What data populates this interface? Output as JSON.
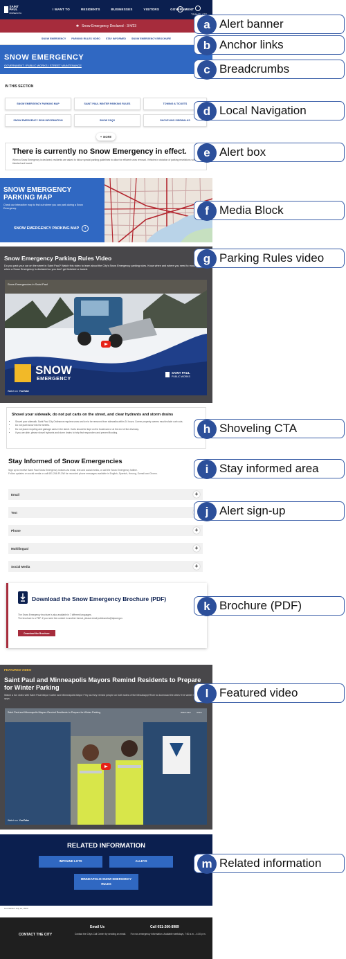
{
  "header": {
    "logo_line1": "SAINT PAUL",
    "logo_line2": "MINNESOTA",
    "nav": [
      "I WANT TO",
      "RESIDENTS",
      "BUSINESSES",
      "VISITORS",
      "GOVERNMENT"
    ],
    "translate": "TRANSLATE"
  },
  "alert_banner": {
    "text": "Snow Emergency Declared - 3/4/23"
  },
  "anchor_links": [
    "SNOW EMERGENCY",
    "PARKING RULES VIDEO",
    "STAY INFORMED",
    "SNOW EMERGENCY BROCHURE"
  ],
  "hero": {
    "title": "SNOW EMERGENCY",
    "breadcrumbs": "GOVERNMENT / PUBLIC WORKS / STREET MAINTENANCE"
  },
  "in_this_section": {
    "label": "IN THIS SECTION",
    "items": [
      "SNOW EMERGENCY PARKING MAP",
      "SAINT PAUL WINTER PARKING RULES",
      "TOWING & TICKETS",
      "SNOW EMERGENCY SIGN INFORMATION",
      "SNOW FAQS",
      "SHOVELING SIDEWALKS"
    ],
    "more_label": "MORE"
  },
  "alert_box": {
    "title": "There is currently no Snow Emergency in effect.",
    "text": "When a Snow Emergency is declared, residents are asked to follow special parking guidelines to allow for efficient snow removal. Vehicles in violation of parking restrictions will be ticketed and towed."
  },
  "media_block": {
    "title": "SNOW EMERGENCY PARKING MAP",
    "text": "Check our interactive map to find out where you can park during a Snow Emergency.",
    "link": "SNOW EMERGENCY PARKING MAP"
  },
  "parking_video": {
    "title": "Snow Emergency Parking Rules Video",
    "text": "Do you park your car on the street in Saint Paul? Watch this video to learn about the City's Snow Emergency parking rules. Know when and where you need to move your car when a Snow Emergency is declared so you don't get ticketed or towed.",
    "video_title": "Snow Emergencies in Saint Paul",
    "overlay_line1": "SNOW",
    "overlay_line2": "EMERGENCY",
    "brand_line1": "SAINT PAUL",
    "brand_line2": "PUBLIC WORKS",
    "watch_on": "Watch on",
    "youtube": "YouTube"
  },
  "shoveling": {
    "title": "Shovel your sidewalk, do not put carts on the street, and clear hydrants and storm drains",
    "bullets": [
      "Shovel your sidewalk. Saint Paul City Ordinance requires snow and ice to be removed from sidewalks within 24 hours. Corner property owners must include curb cuts.",
      "Do not push snow into the streets.",
      "Do not place recycling and garbage carts in the street. Carts should be kept on the boulevard or at the end of the driveway.",
      "If you are able, please shovel hydrants and storm drains to help first responders and prevent flooding."
    ]
  },
  "stay_informed": {
    "title": "Stay Informed of Snow Emergencies",
    "text1": "Sign up to receive Saint Paul Snow Emergency notices via email, text and social media, or call the Snow Emergency hotline.",
    "text2": "Follow updates on social media or call 651-266-PLOW for recorded phone messages available in English, Spanish, Hmong, Somali and Oromo.",
    "accordions": [
      "Email",
      "Text",
      "Phone",
      "Multilingual",
      "Social Media"
    ]
  },
  "brochure": {
    "title": "Download the Snow Emergency Brochure (PDF)",
    "line1": "The Snow Emergency brochure is also available in 7 different languages.",
    "line2": "The brochure is a PDF. If you need the content in another format, please email publicworks@stpaul.gov.",
    "button": "Download the Brochure"
  },
  "featured_video": {
    "label": "FEATURED VIDEO",
    "title": "Saint Paul and Minneapolis Mayors Remind Residents to Prepare for Winter Parking",
    "text": "Watch a fun video with Saint Paul Mayor Carter and Minneapolis Mayor Frey as they remind people on both sides of the Mississippi River to download the cities' free winter street parking apps.",
    "video_title": "Saint Paul and Minneapolis Mayors Remind Residents to Prepare for Winter Parking",
    "watch_later": "Watch later",
    "share": "Share",
    "watch_on": "Watch on",
    "youtube": "YouTube"
  },
  "related": {
    "title": "RELATED INFORMATION",
    "links": [
      "IMPOUND LOTS",
      "ALLEYS",
      "MINNEAPOLIS SNOW EMERGENCY RULES"
    ]
  },
  "last_edited": "Last Edited: July 12, 2023",
  "footer": {
    "contact": "CONTACT THE CITY",
    "email_title": "Email Us",
    "email_text": "Contact the City's Call Center by sending an email.",
    "call_title": "Call 651-266-8989",
    "call_text": "For non-emergency information. Available weekdays, 7:00 a.m. - 4:30 p.m."
  },
  "annotations": [
    {
      "letter": "a",
      "label": "Alert banner"
    },
    {
      "letter": "b",
      "label": "Anchor links"
    },
    {
      "letter": "c",
      "label": "Breadcrumbs"
    },
    {
      "letter": "d",
      "label": "Local Navigation"
    },
    {
      "letter": "e",
      "label": "Alert box"
    },
    {
      "letter": "f",
      "label": "Media Block"
    },
    {
      "letter": "g",
      "label": "Parking Rules video"
    },
    {
      "letter": "h",
      "label": "Shoveling CTA"
    },
    {
      "letter": "i",
      "label": "Stay informed area"
    },
    {
      "letter": "j",
      "label": "Alert sign-up"
    },
    {
      "letter": "k",
      "label": "Brochure (PDF)"
    },
    {
      "letter": "l",
      "label": "Featured video"
    },
    {
      "letter": "m",
      "label": "Related information"
    }
  ],
  "colors": {
    "navy": "#0b1f4f",
    "blue": "#3068c2",
    "red": "#a62c3c",
    "gray": "#48474a",
    "annotation": "#2c4f9a"
  }
}
